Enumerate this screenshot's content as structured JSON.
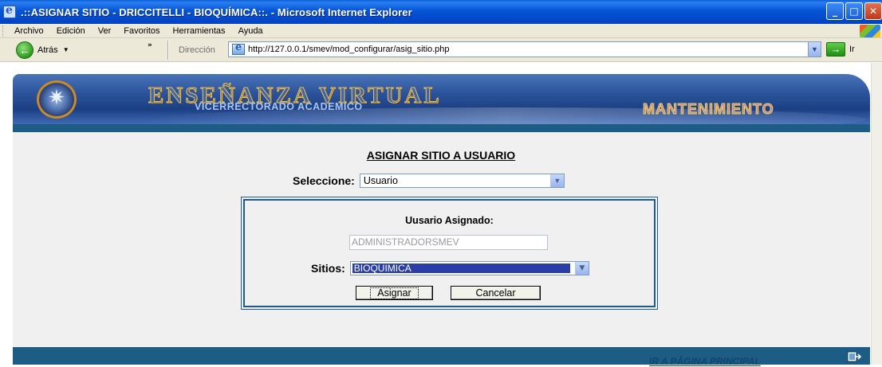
{
  "window": {
    "title": ".::ASIGNAR SITIO - DRICCITELLI - BIOQUÍMICA::. - Microsoft Internet Explorer",
    "minimize": "_",
    "maximize": "□",
    "close": "✕"
  },
  "menu": {
    "items": [
      "Archivo",
      "Edición",
      "Ver",
      "Favoritos",
      "Herramientas",
      "Ayuda"
    ]
  },
  "toolbar": {
    "back_label": "Atrás",
    "more_chevron": "»",
    "address_label": "Dirección",
    "address_url": "http://127.0.0.1/smev/mod_configurar/asig_sitio.php",
    "go_label": "Ir"
  },
  "banner": {
    "title": "ENSEÑANZA VIRTUAL",
    "subtitle": "VICERRECTORADO ACADEMICO",
    "section": "MANTENIMIENTO"
  },
  "form": {
    "title": "ASIGNAR SITIO A USUARIO",
    "select_label": "Seleccione:",
    "select_value": "Usuario",
    "assigned_label": "Uusario Asignado:",
    "assigned_user": "ADMINISTRADORSMEV",
    "sites_label": "Sitios:",
    "sites_value": "BIOQUIMICA",
    "assign_button": "Asignar",
    "cancel_button": "Cancelar"
  },
  "footer": {
    "home_link": "IR A PÁGINA PRINCIPAL"
  },
  "colors": {
    "titlebar": "#0554d6",
    "strip": "#1d5c85",
    "panel": "#f0f0f0",
    "selection": "#2b3ea8"
  },
  "icons": [
    "app-icon",
    "back-arrow-icon",
    "page-icon",
    "go-arrow-icon",
    "dropdown-arrow-icon",
    "emblem-icon",
    "exit-icon",
    "windows-logo-icon"
  ]
}
